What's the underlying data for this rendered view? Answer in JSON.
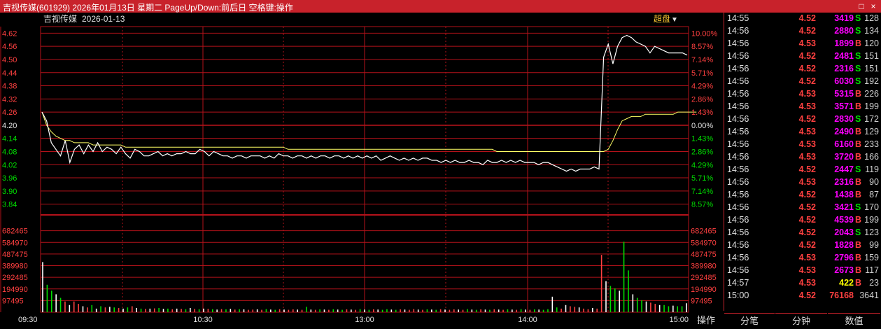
{
  "titlebar": {
    "title": "吉视传媒(601929) 2026年01月13日 星期二 PageUp/Down:前后日 空格键:操作",
    "btn_max": "□",
    "btn_close": "×"
  },
  "chart_header": {
    "stock_name": "吉视传媒",
    "date": "2026-01-13",
    "superimpose_label": "超盘"
  },
  "colors": {
    "up": "#ff4040",
    "down": "#00dd00",
    "grid": "#b4121a",
    "price_line": "#ffffff",
    "avg_line": "#ffff66",
    "volume": "#ff00ff",
    "title_bg": "#c8222b"
  },
  "chart_data": [
    {
      "type": "line",
      "prev_close": 4.2,
      "y_ticks_price": [
        "4.62",
        "4.56",
        "4.50",
        "4.44",
        "4.38",
        "4.32",
        "4.26",
        "4.20",
        "4.14",
        "4.08",
        "4.02",
        "3.96",
        "3.90",
        "3.84"
      ],
      "y_ticks_pct": [
        "10.00%",
        "8.57%",
        "7.14%",
        "5.71%",
        "4.29%",
        "2.86%",
        "1.43%",
        "0.00%",
        "1.43%",
        "2.86%",
        "4.29%",
        "5.71%",
        "7.14%",
        "8.57%"
      ],
      "ylim": [
        3.81,
        4.65
      ],
      "x_ticks": [
        "09:30",
        "10:30",
        "13:00",
        "14:00",
        "15:00"
      ],
      "series": [
        {
          "values": [
            4.26,
            4.22,
            4.12,
            4.09,
            4.06,
            4.13,
            4.03,
            4.09,
            4.11,
            4.07,
            4.11,
            4.08,
            4.12,
            4.08,
            4.1,
            4.09,
            4.07,
            4.1,
            4.07,
            4.05,
            4.09,
            4.08,
            4.06,
            4.06,
            4.07,
            4.08,
            4.06,
            4.07,
            4.06,
            4.07,
            4.07,
            4.08,
            4.07,
            4.07,
            4.09,
            4.08,
            4.06,
            4.08,
            4.07,
            4.06,
            4.06,
            4.05,
            4.06,
            4.06,
            4.05,
            4.06,
            4.06,
            4.06,
            4.05,
            4.06,
            4.05,
            4.07,
            4.06,
            4.06,
            4.05,
            4.06,
            4.06,
            4.05,
            4.06,
            4.05,
            4.06,
            4.06,
            4.05,
            4.06,
            4.06,
            4.05,
            4.06,
            4.05,
            4.06,
            4.05,
            4.06,
            4.05,
            4.06,
            4.04,
            4.05,
            4.06,
            4.05,
            4.04,
            4.05,
            4.04,
            4.05,
            4.04,
            4.05,
            4.05,
            4.04,
            4.04,
            4.03,
            4.04,
            4.03,
            4.04,
            4.03,
            4.03,
            4.04,
            4.03,
            4.03,
            4.02,
            4.04,
            4.03,
            4.03,
            4.04,
            4.03,
            4.04,
            4.03,
            4.04,
            4.03,
            4.03,
            4.03,
            4.02,
            4.03,
            4.03,
            4.02,
            4.01,
            4.0,
            3.99,
            4.0,
            3.99,
            4.0,
            4.0,
            4.0,
            4.01,
            4.0,
            4.51,
            4.57,
            4.48,
            4.56,
            4.6,
            4.61,
            4.6,
            4.58,
            4.57,
            4.56,
            4.53,
            4.56,
            4.55,
            4.54,
            4.53,
            4.53,
            4.53,
            4.53,
            4.52
          ]
        },
        {
          "values": [
            4.26,
            4.2,
            4.17,
            4.15,
            4.14,
            4.13,
            4.13,
            4.12,
            4.12,
            4.12,
            4.12,
            4.11,
            4.11,
            4.11,
            4.11,
            4.11,
            4.11,
            4.11,
            4.1,
            4.1,
            4.1,
            4.1,
            4.1,
            4.1,
            4.1,
            4.1,
            4.1,
            4.1,
            4.1,
            4.1,
            4.1,
            4.1,
            4.1,
            4.1,
            4.1,
            4.1,
            4.1,
            4.1,
            4.1,
            4.1,
            4.1,
            4.1,
            4.1,
            4.1,
            4.1,
            4.1,
            4.1,
            4.1,
            4.1,
            4.1,
            4.1,
            4.1,
            4.1,
            4.09,
            4.09,
            4.09,
            4.09,
            4.09,
            4.09,
            4.09,
            4.09,
            4.09,
            4.09,
            4.09,
            4.09,
            4.09,
            4.09,
            4.09,
            4.09,
            4.09,
            4.09,
            4.09,
            4.09,
            4.09,
            4.09,
            4.09,
            4.09,
            4.09,
            4.09,
            4.09,
            4.09,
            4.09,
            4.09,
            4.09,
            4.09,
            4.09,
            4.09,
            4.09,
            4.09,
            4.09,
            4.09,
            4.09,
            4.09,
            4.09,
            4.09,
            4.09,
            4.09,
            4.09,
            4.08,
            4.08,
            4.08,
            4.08,
            4.08,
            4.08,
            4.08,
            4.08,
            4.08,
            4.08,
            4.08,
            4.08,
            4.08,
            4.08,
            4.08,
            4.08,
            4.08,
            4.08,
            4.08,
            4.08,
            4.08,
            4.08,
            4.08,
            4.08,
            4.09,
            4.13,
            4.18,
            4.22,
            4.23,
            4.24,
            4.24,
            4.24,
            4.25,
            4.25,
            4.25,
            4.25,
            4.25,
            4.25,
            4.25,
            4.26,
            4.26,
            4.26,
            4.26,
            4.26
          ]
        }
      ]
    },
    {
      "type": "bar",
      "y_ticks": [
        "682465",
        "584970",
        "487475",
        "389980",
        "292485",
        "194990",
        "97495"
      ],
      "ylim": [
        0,
        779960
      ],
      "values": [
        420000,
        230000,
        180000,
        150000,
        120000,
        90000,
        60000,
        90000,
        70000,
        50000,
        40000,
        60000,
        30000,
        50000,
        40000,
        45000,
        40000,
        35000,
        30000,
        40000,
        50000,
        35000,
        30000,
        28000,
        30000,
        32000,
        35000,
        28000,
        30000,
        25000,
        30000,
        28000,
        25000,
        35000,
        28000,
        25000,
        30000,
        28000,
        25000,
        22000,
        26000,
        24000,
        28000,
        22000,
        25000,
        24000,
        20000,
        22000,
        24000,
        20000,
        26000,
        22000,
        20000,
        25000,
        22000,
        20000,
        24000,
        22000,
        20000,
        45000,
        22000,
        20000,
        24000,
        22000,
        20000,
        25000,
        22000,
        20000,
        24000,
        22000,
        20000,
        26000,
        22000,
        20000,
        24000,
        22000,
        20000,
        25000,
        22000,
        20000,
        24000,
        22000,
        20000,
        26000,
        22000,
        20000,
        24000,
        22000,
        20000,
        25000,
        22000,
        20000,
        24000,
        22000,
        20000,
        26000,
        22000,
        20000,
        24000,
        22000,
        20000,
        25000,
        22000,
        20000,
        24000,
        22000,
        20000,
        26000,
        22000,
        20000,
        24000,
        22000,
        20000,
        25000,
        130000,
        40000,
        30000,
        60000,
        50000,
        45000,
        40000,
        30000,
        25000,
        35000,
        30000,
        480000,
        260000,
        220000,
        200000,
        180000,
        590000,
        350000,
        150000,
        120000,
        100000,
        90000,
        80000,
        70000,
        60000,
        60000,
        50000,
        55000,
        50000,
        50000,
        75000
      ]
    }
  ],
  "trades": [
    {
      "time": "14:55",
      "price": "4.52",
      "vol": "3419",
      "side": "S",
      "num": "128"
    },
    {
      "time": "14:56",
      "price": "4.52",
      "vol": "2880",
      "side": "S",
      "num": "134"
    },
    {
      "time": "14:56",
      "price": "4.53",
      "vol": "1899",
      "side": "B",
      "num": "120"
    },
    {
      "time": "14:56",
      "price": "4.52",
      "vol": "2481",
      "side": "S",
      "num": "151"
    },
    {
      "time": "14:56",
      "price": "4.52",
      "vol": "2316",
      "side": "S",
      "num": "151"
    },
    {
      "time": "14:56",
      "price": "4.52",
      "vol": "6030",
      "side": "S",
      "num": "192"
    },
    {
      "time": "14:56",
      "price": "4.53",
      "vol": "5315",
      "side": "B",
      "num": "226"
    },
    {
      "time": "14:56",
      "price": "4.53",
      "vol": "3571",
      "side": "B",
      "num": "199"
    },
    {
      "time": "14:56",
      "price": "4.52",
      "vol": "2830",
      "side": "S",
      "num": "172"
    },
    {
      "time": "14:56",
      "price": "4.53",
      "vol": "2490",
      "side": "B",
      "num": "129"
    },
    {
      "time": "14:56",
      "price": "4.53",
      "vol": "6160",
      "side": "B",
      "num": "233"
    },
    {
      "time": "14:56",
      "price": "4.53",
      "vol": "3720",
      "side": "B",
      "num": "166"
    },
    {
      "time": "14:56",
      "price": "4.52",
      "vol": "2447",
      "side": "S",
      "num": "119"
    },
    {
      "time": "14:56",
      "price": "4.53",
      "vol": "2316",
      "side": "B",
      "num": "90"
    },
    {
      "time": "14:56",
      "price": "4.52",
      "vol": "1438",
      "side": "B",
      "num": "87"
    },
    {
      "time": "14:56",
      "price": "4.52",
      "vol": "3421",
      "side": "S",
      "num": "170"
    },
    {
      "time": "14:56",
      "price": "4.52",
      "vol": "4539",
      "side": "B",
      "num": "199"
    },
    {
      "time": "14:56",
      "price": "4.52",
      "vol": "2043",
      "side": "S",
      "num": "123"
    },
    {
      "time": "14:56",
      "price": "4.52",
      "vol": "1828",
      "side": "B",
      "num": "99"
    },
    {
      "time": "14:56",
      "price": "4.53",
      "vol": "2796",
      "side": "B",
      "num": "159"
    },
    {
      "time": "14:56",
      "price": "4.53",
      "vol": "2673",
      "side": "B",
      "num": "117"
    },
    {
      "time": "14:57",
      "price": "4.53",
      "vol": "422",
      "side": "B",
      "num": "23"
    },
    {
      "time": "15:00",
      "price": "4.52",
      "vol": "76168",
      "side": "",
      "num": "3641"
    }
  ],
  "bottom_tabs": {
    "op": "操作",
    "tick": "分笔",
    "minute": "分钟",
    "data": "数值"
  }
}
